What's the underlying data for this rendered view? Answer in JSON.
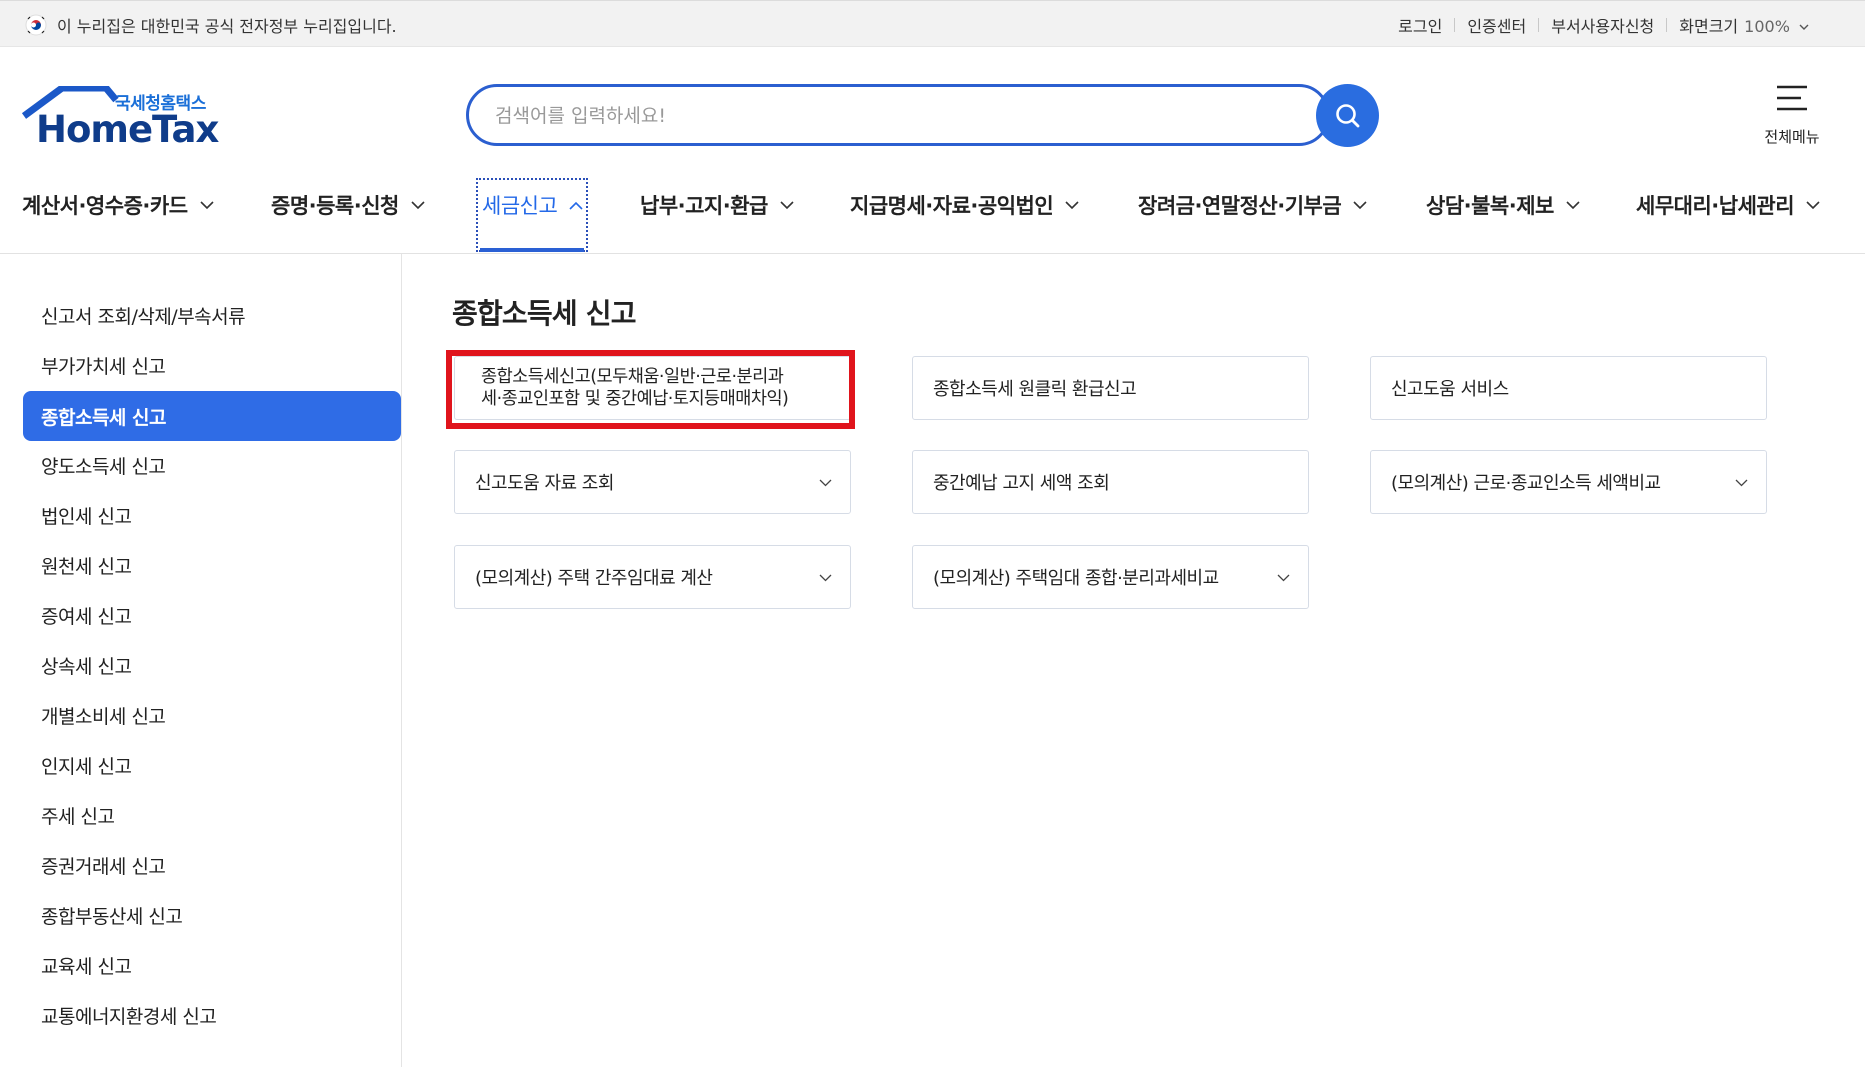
{
  "gov_banner": {
    "text": "이 누리집은 대한민국 공식 전자정부 누리집입니다.",
    "links": [
      "로그인",
      "인증센터",
      "부서사용자신청",
      "화면크기"
    ],
    "zoom": "100%"
  },
  "logo": {
    "subtitle": "국세청홈택스",
    "title": "HomeTax"
  },
  "search": {
    "placeholder": "검색어를 입력하세요!"
  },
  "all_menu": {
    "label": "전체메뉴"
  },
  "gnb": [
    "계산서·영수증·카드",
    "증명·등록·신청",
    "세금신고",
    "납부·고지·환급",
    "지급명세·자료·공익법인",
    "장려금·연말정산·기부금",
    "상담·불복·제보",
    "세무대리·납세관리"
  ],
  "gnb_active_index": 2,
  "lnb": [
    "신고서 조회/삭제/부속서류",
    "부가가치세 신고",
    "종합소득세 신고",
    "양도소득세 신고",
    "법인세 신고",
    "원천세 신고",
    "증여세 신고",
    "상속세 신고",
    "개별소비세 신고",
    "인지세 신고",
    "주세 신고",
    "증권거래세 신고",
    "종합부동산세 신고",
    "교육세 신고",
    "교통에너지환경세 신고"
  ],
  "lnb_active_index": 2,
  "main": {
    "title": "종합소득세 신고",
    "cards": [
      {
        "label": "종합소득세신고(모두채움·일반·근로·분리과세·종교인포함 및 중간예납·토지등매매차익)",
        "line1": "종합소득세신고(모두채움·일반·근로·분리과",
        "line2": "세·종교인포함 및 중간예납·토지등매매차익)",
        "dropdown": false
      },
      {
        "label": "종합소득세 원클릭 환급신고",
        "dropdown": false
      },
      {
        "label": "신고도움 서비스",
        "dropdown": false
      },
      {
        "label": "신고도움 자료 조회",
        "dropdown": true
      },
      {
        "label": "중간예납 고지 세액 조회",
        "dropdown": false
      },
      {
        "label": "(모의계산) 근로·종교인소득 세액비교",
        "dropdown": true
      },
      {
        "label": "(모의계산) 주택 간주임대료 계산",
        "dropdown": true
      },
      {
        "label": "(모의계산) 주택임대 종합·분리과세비교",
        "dropdown": true
      }
    ]
  },
  "colors": {
    "brand_blue": "#2f6ce6",
    "highlight_red": "#e0141c",
    "logo_navy": "#0f3c8a"
  }
}
